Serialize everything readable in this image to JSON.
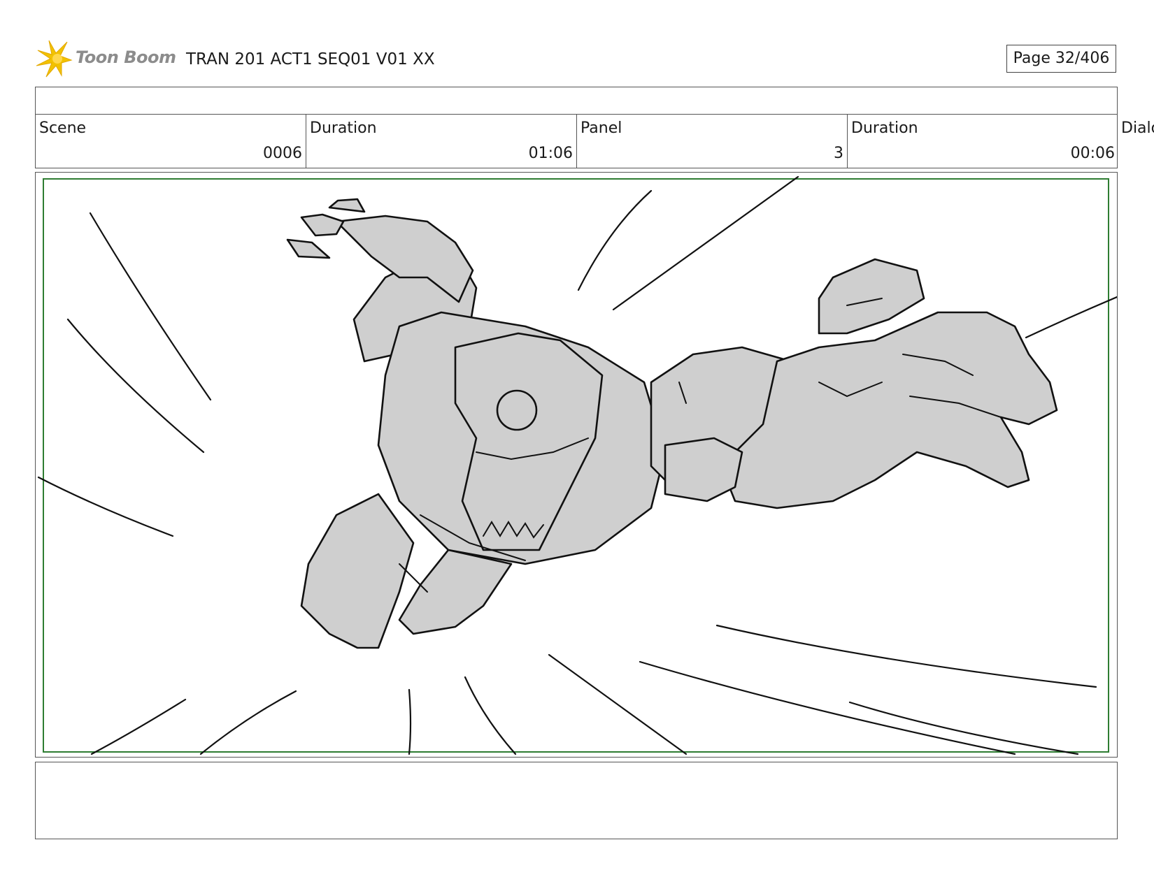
{
  "header": {
    "brand": "Toon Boom",
    "document_title": "TRAN 201 ACT1 SEQ01 V01 XX",
    "page_label": "Page",
    "page_number": "32/406"
  },
  "info": {
    "scene_label": "Scene",
    "scene_value": "0006",
    "scene_duration_label": "Duration",
    "scene_duration_value": "01:06",
    "panel_label": "Panel",
    "panel_value": "3",
    "panel_duration_label": "Duration",
    "panel_duration_value": "00:06",
    "dialogue_label": "Dialo"
  },
  "colors": {
    "brand_star": "#f2c200",
    "safe_frame": "#2e7d32",
    "sketch_fill": "#cfcfcf",
    "sketch_line": "#111111"
  },
  "icons": {
    "logo": "starburst-icon"
  }
}
